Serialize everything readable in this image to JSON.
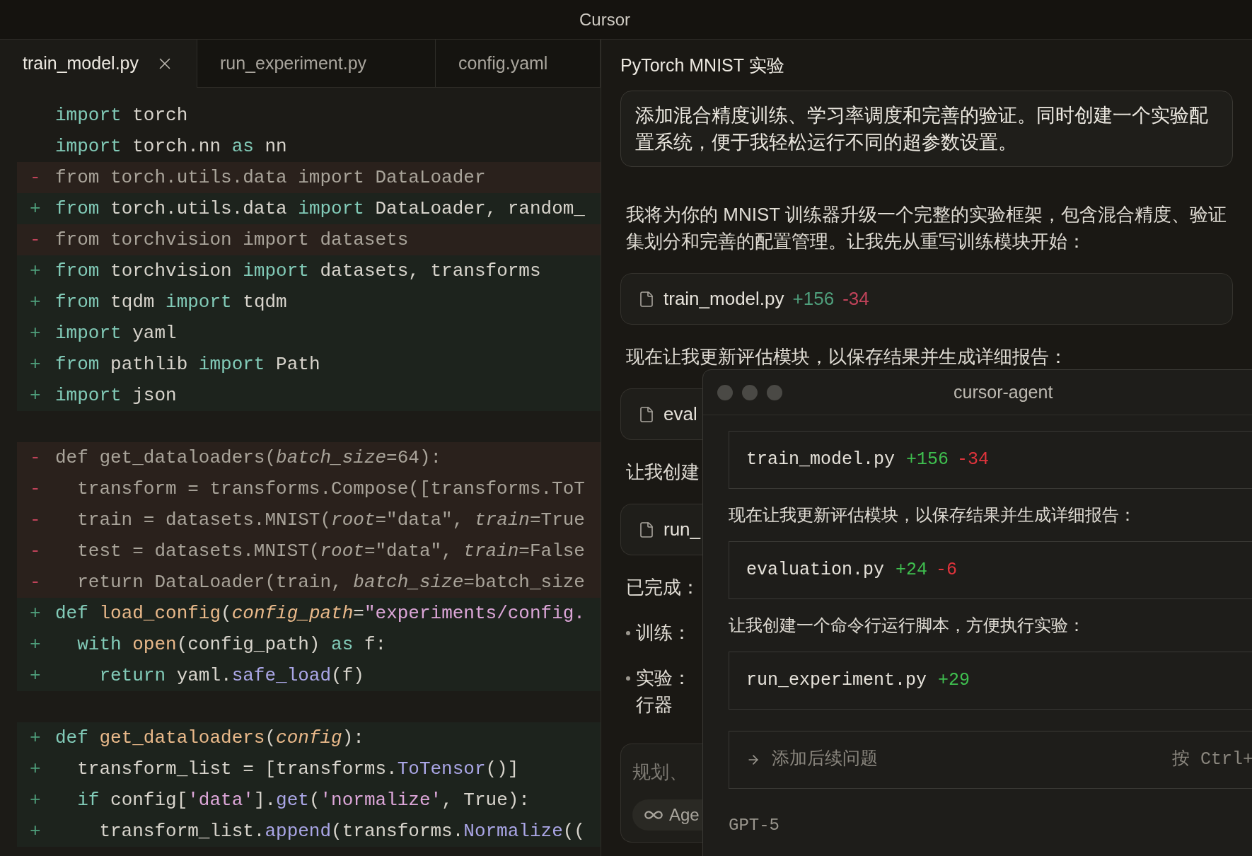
{
  "window": {
    "title": "Cursor"
  },
  "tabs": [
    {
      "label": "train_model.py",
      "selected": true
    },
    {
      "label": "run_experiment.py",
      "selected": false
    },
    {
      "label": "config.yaml",
      "selected": false
    }
  ],
  "hunks": [
    {
      "lines": [
        {
          "kind": "context",
          "tokens": [
            {
              "text": "import",
              "kind": "keyword"
            },
            {
              "text": " torch",
              "kind": "plain"
            }
          ]
        },
        {
          "kind": "context",
          "tokens": [
            {
              "text": "import",
              "kind": "keyword"
            },
            {
              "text": " torch.nn ",
              "kind": "plain"
            },
            {
              "text": "as",
              "kind": "keyword"
            },
            {
              "text": " nn",
              "kind": "plain"
            }
          ]
        },
        {
          "kind": "removed",
          "marker": "-",
          "tokens": [
            {
              "text": "from torch.utils.data import DataLoader",
              "kind": "plain"
            }
          ]
        },
        {
          "kind": "added",
          "marker": "+",
          "tokens": [
            {
              "text": "from",
              "kind": "keyword"
            },
            {
              "text": " torch.utils.data ",
              "kind": "plain"
            },
            {
              "text": "import",
              "kind": "keyword"
            },
            {
              "text": " DataLoader, random_",
              "kind": "plain"
            }
          ]
        },
        {
          "kind": "removed",
          "marker": "-",
          "tokens": [
            {
              "text": "from torchvision import datasets",
              "kind": "plain"
            }
          ]
        },
        {
          "kind": "added",
          "marker": "+",
          "tokens": [
            {
              "text": "from",
              "kind": "keyword"
            },
            {
              "text": " torchvision ",
              "kind": "plain"
            },
            {
              "text": "import",
              "kind": "keyword"
            },
            {
              "text": " datasets, transforms",
              "kind": "plain"
            }
          ]
        },
        {
          "kind": "added",
          "marker": "+",
          "tokens": [
            {
              "text": "from",
              "kind": "keyword"
            },
            {
              "text": " tqdm ",
              "kind": "plain"
            },
            {
              "text": "import",
              "kind": "keyword"
            },
            {
              "text": " tqdm",
              "kind": "plain"
            }
          ]
        },
        {
          "kind": "added",
          "marker": "+",
          "tokens": [
            {
              "text": "import",
              "kind": "keyword"
            },
            {
              "text": " yaml",
              "kind": "plain"
            }
          ]
        },
        {
          "kind": "added",
          "marker": "+",
          "tokens": [
            {
              "text": "from",
              "kind": "keyword"
            },
            {
              "text": " pathlib ",
              "kind": "plain"
            },
            {
              "text": "import",
              "kind": "keyword"
            },
            {
              "text": " Path",
              "kind": "plain"
            }
          ]
        },
        {
          "kind": "added",
          "marker": "+",
          "tokens": [
            {
              "text": "import",
              "kind": "keyword"
            },
            {
              "text": " json",
              "kind": "plain"
            }
          ]
        }
      ]
    },
    {
      "lines": [
        {
          "kind": "removed",
          "marker": "-",
          "tokens": [
            {
              "text": "def get_dataloaders(",
              "kind": "plain"
            },
            {
              "text": "batch_size",
              "kind": "param"
            },
            {
              "text": "=64):",
              "kind": "plain"
            }
          ]
        },
        {
          "kind": "removed",
          "marker": "-",
          "tokens": [
            {
              "text": "  transform = transforms.Compose([transforms.ToT",
              "kind": "plain"
            }
          ]
        },
        {
          "kind": "removed",
          "marker": "-",
          "tokens": [
            {
              "text": "  train = datasets.MNIST(",
              "kind": "plain"
            },
            {
              "text": "root",
              "kind": "param"
            },
            {
              "text": "=\"data\", ",
              "kind": "plain"
            },
            {
              "text": "train",
              "kind": "param"
            },
            {
              "text": "=True",
              "kind": "plain"
            }
          ]
        },
        {
          "kind": "removed",
          "marker": "-",
          "tokens": [
            {
              "text": "  test = datasets.MNIST(",
              "kind": "plain"
            },
            {
              "text": "root",
              "kind": "param"
            },
            {
              "text": "=\"data\", ",
              "kind": "plain"
            },
            {
              "text": "train",
              "kind": "param"
            },
            {
              "text": "=False",
              "kind": "plain"
            }
          ]
        },
        {
          "kind": "removed",
          "marker": "-",
          "tokens": [
            {
              "text": "  return DataLoader(train, ",
              "kind": "plain"
            },
            {
              "text": "batch_size",
              "kind": "param"
            },
            {
              "text": "=batch_size",
              "kind": "plain"
            }
          ]
        },
        {
          "kind": "added",
          "marker": "+",
          "tokens": [
            {
              "text": "def ",
              "kind": "keyword"
            },
            {
              "text": "load_config",
              "kind": "function"
            },
            {
              "text": "(",
              "kind": "plain"
            },
            {
              "text": "config_path",
              "kind": "param"
            },
            {
              "text": "=",
              "kind": "plain"
            },
            {
              "text": "\"experiments/config.",
              "kind": "string"
            }
          ]
        },
        {
          "kind": "added",
          "marker": "+",
          "tokens": [
            {
              "text": "  with ",
              "kind": "keyword"
            },
            {
              "text": "open",
              "kind": "function"
            },
            {
              "text": "(config_path) ",
              "kind": "plain"
            },
            {
              "text": "as",
              "kind": "keyword"
            },
            {
              "text": " f:",
              "kind": "plain"
            }
          ]
        },
        {
          "kind": "added",
          "marker": "+",
          "tokens": [
            {
              "text": "    return",
              "kind": "keyword"
            },
            {
              "text": " yaml.",
              "kind": "plain"
            },
            {
              "text": "safe_load",
              "kind": "method"
            },
            {
              "text": "(f)",
              "kind": "plain"
            }
          ]
        }
      ]
    },
    {
      "lines": [
        {
          "kind": "added",
          "marker": "+",
          "tokens": [
            {
              "text": "def ",
              "kind": "keyword"
            },
            {
              "text": "get_dataloaders",
              "kind": "function"
            },
            {
              "text": "(",
              "kind": "plain"
            },
            {
              "text": "config",
              "kind": "param"
            },
            {
              "text": "):",
              "kind": "plain"
            }
          ]
        },
        {
          "kind": "added",
          "marker": "+",
          "tokens": [
            {
              "text": "  transform_list = [transforms.",
              "kind": "plain"
            },
            {
              "text": "ToTensor",
              "kind": "method"
            },
            {
              "text": "()]",
              "kind": "plain"
            }
          ]
        },
        {
          "kind": "added",
          "marker": "+",
          "tokens": [
            {
              "text": "  if",
              "kind": "keyword"
            },
            {
              "text": " config[",
              "kind": "plain"
            },
            {
              "text": "'data'",
              "kind": "string"
            },
            {
              "text": "].",
              "kind": "plain"
            },
            {
              "text": "get",
              "kind": "method"
            },
            {
              "text": "(",
              "kind": "plain"
            },
            {
              "text": "'normalize'",
              "kind": "string"
            },
            {
              "text": ", True):",
              "kind": "plain"
            }
          ]
        },
        {
          "kind": "added",
          "marker": "+",
          "tokens": [
            {
              "text": "    transform_list.",
              "kind": "plain"
            },
            {
              "text": "append",
              "kind": "method"
            },
            {
              "text": "(transforms.",
              "kind": "plain"
            },
            {
              "text": "Normalize",
              "kind": "method"
            },
            {
              "text": "((",
              "kind": "plain"
            }
          ]
        }
      ]
    }
  ],
  "chat": {
    "title": "PyTorch MNIST 实验",
    "prompt": "添加混合精度训练、学习率调度和完善的验证。同时创建一个实验配置系统，便于我轻松运行不同的超参数设置。",
    "items": [
      {
        "kind": "text",
        "text": "我将为你的 MNIST 训练器升级一个完整的实验框架，包含混合精度、验证集划分和完善的配置管理。让我先从重写训练模块开始："
      },
      {
        "kind": "file",
        "name": "train_model.py",
        "added": "+156",
        "removed": "-34"
      },
      {
        "kind": "text",
        "text": "现在让我更新评估模块，以保存结果并生成详细报告："
      },
      {
        "kind": "file",
        "name": "eval"
      },
      {
        "kind": "text",
        "text": "让我创建"
      },
      {
        "kind": "file",
        "name": "run_"
      },
      {
        "kind": "text",
        "text": "已完成："
      },
      {
        "kind": "bullet",
        "text": "训练："
      },
      {
        "kind": "bullet",
        "text": "实验：行器"
      }
    ],
    "composer": {
      "placeholder": "规划、",
      "mode": "Age"
    }
  },
  "terminal": {
    "title": "cursor-agent",
    "items": [
      {
        "kind": "file",
        "name": "train_model.py",
        "added": "+156",
        "removed": "-34"
      },
      {
        "kind": "text",
        "text": "现在让我更新评估模块，以保存结果并生成详细报告："
      },
      {
        "kind": "file",
        "name": "evaluation.py",
        "added": "+24",
        "removed": "-6"
      },
      {
        "kind": "text",
        "text": "让我创建一个命令行运行脚本，方便执行实验："
      },
      {
        "kind": "file",
        "name": "run_experiment.py",
        "added": "+29"
      }
    ],
    "input": {
      "placeholder": "添加后续问题",
      "hint": "按 Ctrl+"
    },
    "model": "GPT-5"
  }
}
